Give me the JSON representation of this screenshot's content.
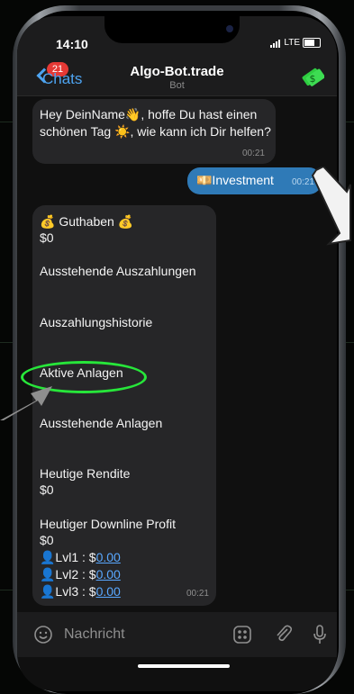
{
  "status_bar": {
    "time": "14:10",
    "network": "LTE"
  },
  "header": {
    "back_label": "Chats",
    "unread_badge": "21",
    "chat_title": "Algo-Bot.trade",
    "chat_subtitle": "Bot"
  },
  "messages": {
    "greeting": {
      "text": "Hey DeinName👋, hoffe Du hast einen schönen Tag ☀️, wie kann ich Dir helfen?",
      "time": "00:21"
    },
    "outgoing": {
      "text": "💴Investment",
      "time": "00:21"
    },
    "balance": {
      "title": "💰 Guthaben 💰",
      "balance_value": "$0",
      "pending_payouts": "Ausstehende Auszahlungen",
      "payout_history": "Auszahlungshistorie",
      "active_investments": "Aktive Anlagen",
      "pending_investments": "Ausstehende Anlagen",
      "today_return_label": "Heutige Rendite",
      "today_return_value": "$0",
      "downline_label": "Heutiger Downline Profit",
      "downline_value": "$0",
      "levels": [
        {
          "label": "👤Lvl1 : $",
          "value": "0.00"
        },
        {
          "label": "👤Lvl2 : $",
          "value": "0.00"
        },
        {
          "label": "👤Lvl3 : $",
          "value": "0.00"
        }
      ],
      "time": "00:21"
    }
  },
  "composer": {
    "placeholder": "Nachricht"
  },
  "colors": {
    "accent": "#4da3f0",
    "outgoing_bubble": "#2f7ab7",
    "incoming_bubble": "#262628",
    "highlight_ring": "#27e63a",
    "badge": "#e53935"
  }
}
